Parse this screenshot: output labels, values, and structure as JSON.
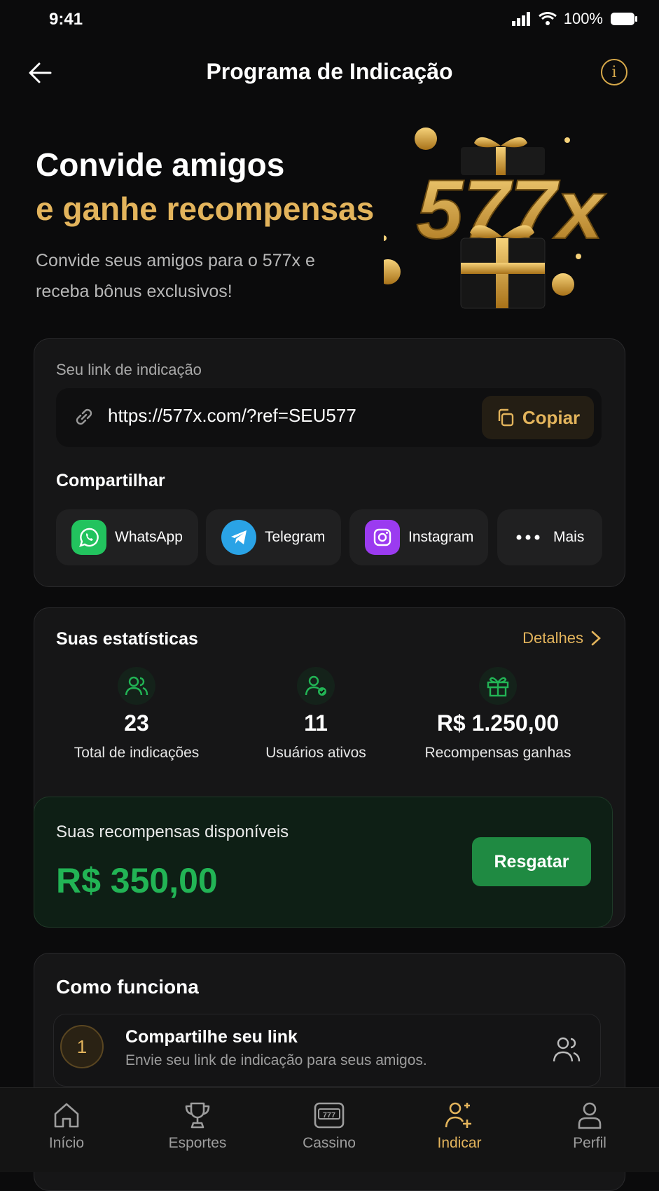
{
  "status": {
    "time": "9:41",
    "battery": "100%"
  },
  "header": {
    "title": "Programa de Indicação",
    "back_icon": "arrow-left-icon",
    "info_icon": "info-icon"
  },
  "hero": {
    "line1": "Convide amigos",
    "line2": "e ganhe recompensas",
    "subtitle": "Convide seus amigos para o 577x e receba bônus exclusivos!",
    "logo_text": "577x"
  },
  "referral": {
    "label": "Seu link de indicação",
    "link": "https://577x.com/?ref=SEU577",
    "copy_label": "Copiar",
    "share_heading": "Compartilhar",
    "share": [
      {
        "label": "WhatsApp",
        "icon": "whatsapp-icon",
        "color": "#22c35e"
      },
      {
        "label": "Telegram",
        "icon": "telegram-icon",
        "color": "#2aa3e6"
      },
      {
        "label": "Instagram",
        "icon": "instagram-icon",
        "color": "#9b3bf0"
      },
      {
        "label": "Mais",
        "icon": "more-dots-icon"
      }
    ]
  },
  "stats": {
    "heading": "Suas estatísticas",
    "details_label": "Detalhes",
    "items": [
      {
        "value": "23",
        "label": "Total de indicações",
        "icon": "users-icon"
      },
      {
        "value": "11",
        "label": "Usuários ativos",
        "icon": "user-check-icon"
      },
      {
        "value": "R$ 1.250,00",
        "label": "Recompensas ganhas",
        "icon": "gift-icon"
      }
    ],
    "available_label": "Suas recompensas disponíveis",
    "available_value": "R$ 350,00",
    "redeem_label": "Resgatar"
  },
  "how": {
    "heading": "Como funciona",
    "steps": [
      {
        "number": "1",
        "title": "Compartilhe seu link",
        "desc": "Envie seu link de indicação para seus amigos.",
        "icon": "users-icon"
      }
    ]
  },
  "tabs": [
    {
      "label": "Início",
      "icon": "home-icon"
    },
    {
      "label": "Esportes",
      "icon": "trophy-icon"
    },
    {
      "label": "Cassino",
      "icon": "slot-machine-icon"
    },
    {
      "label": "Indicar",
      "icon": "user-plus-icon",
      "active": true
    },
    {
      "label": "Perfil",
      "icon": "user-icon"
    }
  ],
  "colors": {
    "accent": "#e3b45c",
    "green": "#22b455",
    "background": "#0b0b0c"
  }
}
